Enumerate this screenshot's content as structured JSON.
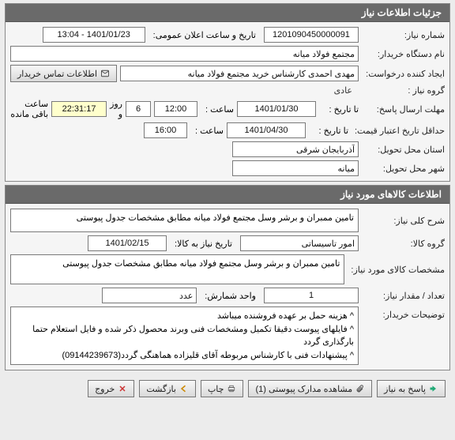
{
  "sections": {
    "need_details_title": "جزئیات اطلاعات نیاز",
    "goods_details_title": "اطلاعات کالاهای مورد نیاز"
  },
  "fields": {
    "need_number_label": "شماره نیاز:",
    "need_number": "1201090450000091",
    "announce_datetime_label": "تاریخ و ساعت اعلان عمومی:",
    "announce_datetime": "1401/01/23 - 13:04",
    "buyer_org_label": "نام دستگاه خریدار:",
    "buyer_org": "مجتمع فولاد میانه",
    "requester_label": "ایجاد کننده درخواست:",
    "requester": "مهدی احمدی کارشناس خرید مجتمع فولاد میانه",
    "buyer_contact_btn": "اطلاعات تماس خریدار",
    "need_group_label": "گروه نیاز :",
    "need_group": "عادی",
    "reply_deadline_label": "مهلت ارسال پاسخ:",
    "to_date_label": "تا تاریخ :",
    "reply_to_date": "1401/01/30",
    "hour_label": "ساعت :",
    "reply_hour": "12:00",
    "days_count": "6",
    "days_and": "روز و",
    "countdown": "22:31:17",
    "remaining_text": "ساعت باقی مانده",
    "price_validity_label": "حداقل تاریخ اعتبار قیمت:",
    "price_to_date": "1401/04/30",
    "price_hour": "16:00",
    "delivery_province_label": "استان محل تحویل:",
    "delivery_province": "آذربایجان شرقی",
    "delivery_city_label": "شهر محل تحویل:",
    "delivery_city": "میانه",
    "need_summary_label": "شرح کلی نیاز:",
    "need_summary": "تامین ممبران و برشر وسل   مجتمع فولاد میانه مطابق مشخصات جدول پیوستی",
    "goods_group_label": "گروه کالا:",
    "goods_group": "امور تاسیساتی",
    "goods_date_label": "تاریخ نیاز به کالا:",
    "goods_date": "1401/02/15",
    "goods_spec_label": "مشخصات کالای مورد نیاز:",
    "goods_spec": "تامین ممبران و برشر وسل   مجتمع فولاد میانه مطابق مشخصات جدول پیوستی",
    "qty_label": "تعداد / مقدار نیاز:",
    "qty": "1",
    "unit_label": "واحد شمارش:",
    "unit": "عدد",
    "buyer_notes_label": "توضیحات خریدار:",
    "buyer_notes": "^ هزینه حمل بر عهده فروشنده میباشد\n^ فایلهای پیوست دقیقا تکمیل ومشخصات فنی وبرند محصول ذکر شده و فایل استعلام حتما بارگذاری گردد\n^ پیشنهادات فنی با کارشناس مربوطه آقای قلیزاده هماهنگی گردد(09144239673)"
  },
  "actions": {
    "reply": "پاسخ به نیاز",
    "attachments": "مشاهده مدارک پیوستی (1)",
    "print": "چاپ",
    "back": "بازگشت",
    "exit": "خروج"
  }
}
